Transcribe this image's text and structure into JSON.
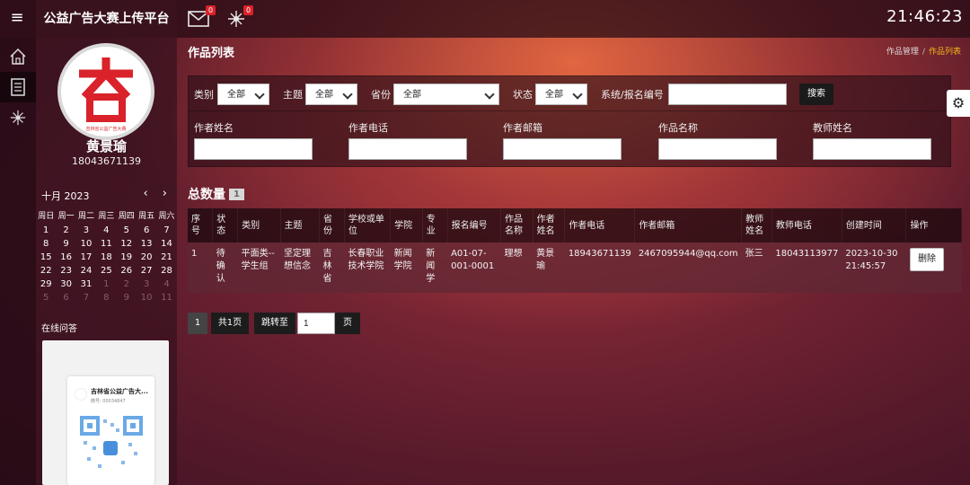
{
  "app": {
    "title": "公益广告大赛上传平台",
    "clock": "21:46:23"
  },
  "topbar": {
    "mail_badge": "0",
    "network_badge": "0"
  },
  "user": {
    "name": "黄景瑜",
    "phone": "18043671139",
    "logo_caption": "吉林省公益广告大赛"
  },
  "calendar": {
    "month_label": "十月 2023",
    "nav": "‹ ›",
    "weekdays": [
      "周日",
      "周一",
      "周二",
      "周三",
      "周四",
      "周五",
      "周六"
    ],
    "weeks": [
      [
        "1",
        "2",
        "3",
        "4",
        "5",
        "6",
        "7"
      ],
      [
        "8",
        "9",
        "10",
        "11",
        "12",
        "13",
        "14"
      ],
      [
        "15",
        "16",
        "17",
        "18",
        "19",
        "20",
        "21"
      ],
      [
        "22",
        "23",
        "24",
        "25",
        "26",
        "27",
        "28"
      ],
      [
        "29",
        "30",
        "31",
        "1",
        "2",
        "3",
        "4"
      ],
      [
        "5",
        "6",
        "7",
        "8",
        "9",
        "10",
        "11"
      ]
    ]
  },
  "qa": {
    "title": "在线问答",
    "org": "吉林省公益广告大...",
    "sub": "微号: 00034847"
  },
  "page": {
    "title": "作品列表",
    "breadcrumb_root": "作品管理",
    "breadcrumb_sep": "/",
    "breadcrumb_current": "作品列表"
  },
  "filters": {
    "category_label": "类别",
    "category_value": "全部",
    "theme_label": "主题",
    "theme_value": "全部",
    "province_label": "省份",
    "province_value": "全部",
    "status_label": "状态",
    "status_value": "全部",
    "regno_label": "系统/报名编号",
    "regno_value": "",
    "search_label": "搜索",
    "author_name_label": "作者姓名",
    "author_phone_label": "作者电话",
    "author_email_label": "作者邮箱",
    "work_name_label": "作品名称",
    "teacher_name_label": "教师姓名"
  },
  "total": {
    "label": "总数量",
    "count": "1"
  },
  "table": {
    "headers": [
      "序号",
      "状态",
      "类别",
      "主题",
      "省份",
      "学校或单位",
      "学院",
      "专业",
      "报名编号",
      "作品名称",
      "作者姓名",
      "作者电话",
      "作者邮箱",
      "教师姓名",
      "教师电话",
      "创建时间",
      "操作"
    ],
    "rows": [
      {
        "no": "1",
        "status": "待确认",
        "category": "平面类--学生组",
        "theme": "坚定理想信念",
        "province": "吉林省",
        "school": "长春职业技术学院",
        "college": "新闻学院",
        "major": "新闻学",
        "reg_no": "A01-07-001-0001",
        "work_name": "理想",
        "author_name": "黄景瑜",
        "author_phone": "18943671139",
        "author_email": "2467095944@qq.com",
        "teacher_name": "张三",
        "teacher_phone": "18043113977",
        "created": "2023-10-30 21:45:57",
        "action": "删除"
      }
    ]
  },
  "pager": {
    "current": "1",
    "total_pages": "共1页",
    "jump_label": "跳转至",
    "jump_value": "1",
    "page_unit": "页"
  },
  "colors": {
    "accent": "#f5b81c",
    "badge": "#d9222a",
    "logo_red": "#d9222a"
  }
}
